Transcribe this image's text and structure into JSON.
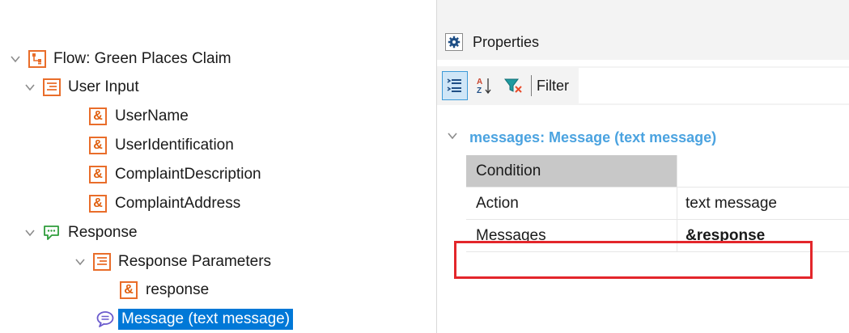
{
  "tree": {
    "flow": "Flow: Green Places Claim",
    "user_input": "User Input",
    "vars": [
      "UserName",
      "UserIdentification",
      "ComplaintDescription",
      "ComplaintAddress"
    ],
    "response": "Response",
    "response_params": "Response Parameters",
    "response_var": "response",
    "message": "Message (text message)",
    "amp": "&"
  },
  "panel": {
    "title": "Properties",
    "filter_label": "Filter",
    "group_title": "messages: Message (text message)",
    "rows": [
      {
        "name": "Condition",
        "value": ""
      },
      {
        "name": "Action",
        "value": "text message"
      },
      {
        "name": "Messages",
        "value": "&response"
      }
    ]
  },
  "colors": {
    "accent_orange": "#e96d2a",
    "tree_green": "#2e9d3b",
    "selection_blue": "#0078d7",
    "group_blue": "#4ba3e0",
    "highlight_red": "#e3262b"
  }
}
